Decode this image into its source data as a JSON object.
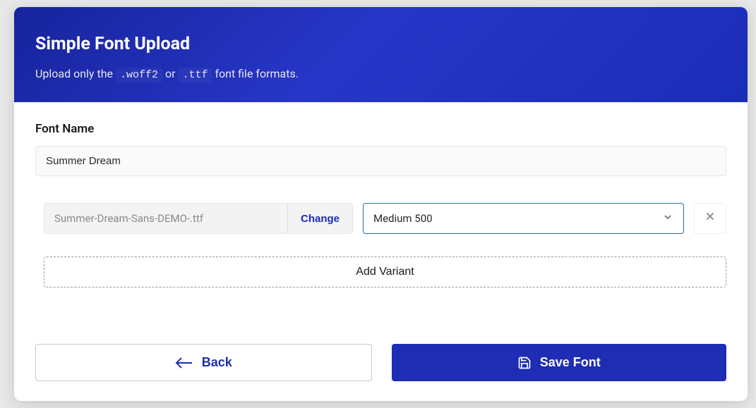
{
  "modal": {
    "title": "Simple Font Upload",
    "subtitle_1": "Upload only the ",
    "subtitle_code1": ".woff2",
    "subtitle_or": " or ",
    "subtitle_code2": ".ttf",
    "subtitle_2": " font file formats."
  },
  "form": {
    "font_name_label": "Font Name",
    "font_name_value": "Summer Dream"
  },
  "variant": {
    "file_name": "Summer-Dream-Sans-DEMO-.ttf",
    "change_label": "Change",
    "weight_value": "Medium 500",
    "add_variant_label": "Add Variant"
  },
  "footer": {
    "back_label": "Back",
    "save_label": "Save Font"
  }
}
